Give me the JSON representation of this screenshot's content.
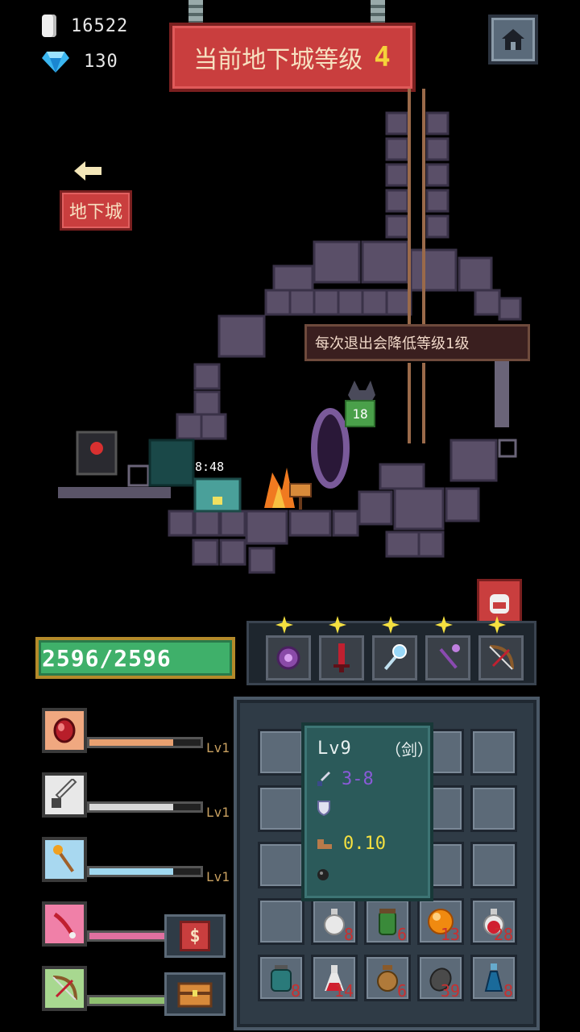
{
  "currency": {
    "coins": "16522",
    "gems": "130"
  },
  "banner": {
    "label": "当前地下城等级",
    "level": "4"
  },
  "nav": {
    "dungeon_label": "地下城"
  },
  "tip": "每次退出会降低等级1级",
  "scene": {
    "timer": "8:48",
    "enemy_level": "18"
  },
  "player": {
    "hp": "2596/2596"
  },
  "skills": [
    {
      "icon": "ruby-icon",
      "level": "Lv1",
      "fill": 0.75,
      "color": "#e8a070"
    },
    {
      "icon": "sword-icon",
      "level": "Lv1",
      "fill": 0.75,
      "color": "#d8d8d8"
    },
    {
      "icon": "staff-icon",
      "level": "Lv1",
      "fill": 0.75,
      "color": "#a0d8f0"
    },
    {
      "icon": "claw-icon",
      "level": "",
      "fill": 1.0,
      "color": "#e070a0"
    },
    {
      "icon": "bow-icon",
      "level": "",
      "fill": 1.0,
      "color": "#90c070"
    }
  ],
  "weapon_slots": [
    "orb-icon",
    "red-sword-icon",
    "ice-staff-icon",
    "purple-staff-icon",
    "bow-icon"
  ],
  "tooltip": {
    "level": "Lv9",
    "type": "（剑）",
    "attack": "3-8",
    "speed": "0.10",
    "attack_color": "#8a5ad8",
    "speed_color": "#f5e040"
  },
  "inventory": {
    "row4": [
      {
        "icon": "",
        "count": ""
      },
      {
        "icon": "white-potion-icon",
        "count": "8"
      },
      {
        "icon": "green-jar-icon",
        "count": "6"
      },
      {
        "icon": "orange-orb-icon",
        "count": "13"
      },
      {
        "icon": "red-potion-icon",
        "count": "28"
      }
    ],
    "row5": [
      {
        "icon": "teal-jar-icon",
        "count": "8"
      },
      {
        "icon": "red-flask-icon",
        "count": "14"
      },
      {
        "icon": "bronze-vase-icon",
        "count": "6"
      },
      {
        "icon": "stone-icon",
        "count": "39"
      },
      {
        "icon": "blue-potion-icon",
        "count": "8"
      }
    ]
  }
}
